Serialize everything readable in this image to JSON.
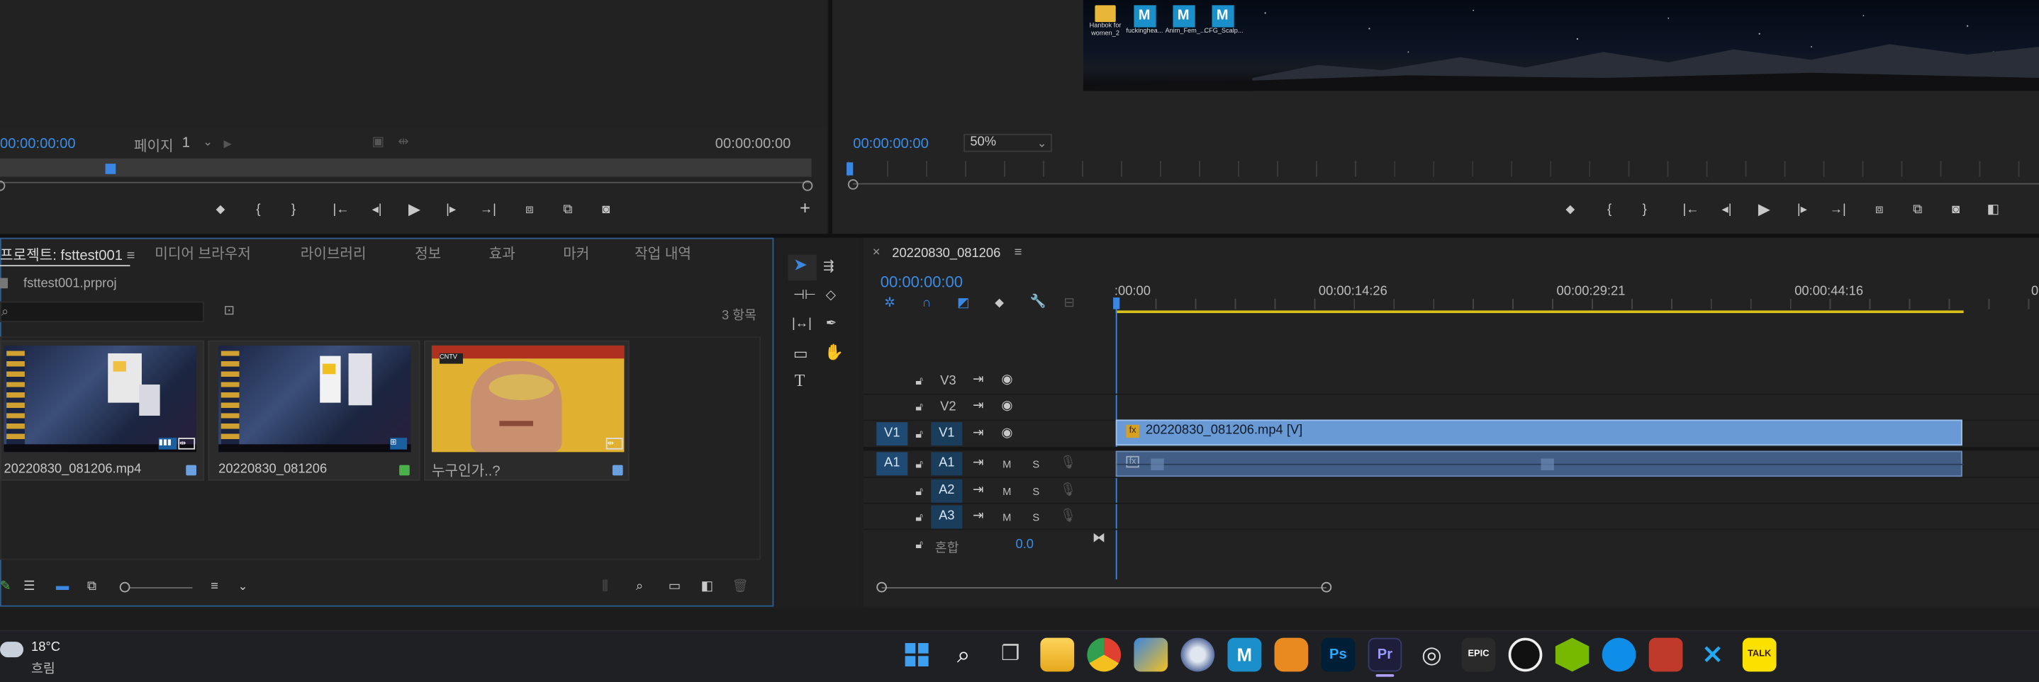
{
  "source_monitor": {
    "timecode_left": "00:00:00:00",
    "page_label": "페이지",
    "page_value": "1",
    "timecode_right": "00:00:00:00"
  },
  "program_monitor": {
    "timecode": "00:00:00:00",
    "zoom": "50%",
    "desktop_icons": [
      {
        "label": "Hanbok for women_2",
        "kind": "folder"
      },
      {
        "label": "fuckinghea...",
        "kind": "maya"
      },
      {
        "label": "Anim_Fem_...",
        "kind": "maya"
      },
      {
        "label": "CFG_Scalp...",
        "kind": "maya"
      }
    ]
  },
  "project_panel": {
    "tabs": [
      "프로젝트: fsttest001",
      "미디어 브라우저",
      "라이브러리",
      "정보",
      "효과",
      "마커",
      "작업 내역"
    ],
    "file": "fsttest001.prproj",
    "item_count": "3 항목",
    "items": [
      {
        "name": "20220830_081206.mp4",
        "color": "#6a9fe0"
      },
      {
        "name": "20220830_081206",
        "color": "#49b04a"
      },
      {
        "name": "누구인가..?",
        "color": "#6a9fe0"
      }
    ]
  },
  "timeline": {
    "sequence_name": "20220830_081206",
    "timecode": "00:00:00:00",
    "ruler": [
      ":00:00",
      "00:00:14:26",
      "00:00:29:21",
      "00:00:44:16"
    ],
    "video_tracks": [
      "V3",
      "V2",
      "V1"
    ],
    "audio_tracks": [
      "A1",
      "A2",
      "A3"
    ],
    "source_v": "V1",
    "source_a": "A1",
    "mix_label": "혼합",
    "mix_value": "0.0",
    "clip_label": "20220830_081206.mp4 [V]",
    "m": "M",
    "s": "S"
  },
  "taskbar": {
    "temperature": "18°C",
    "weather": "흐림"
  }
}
